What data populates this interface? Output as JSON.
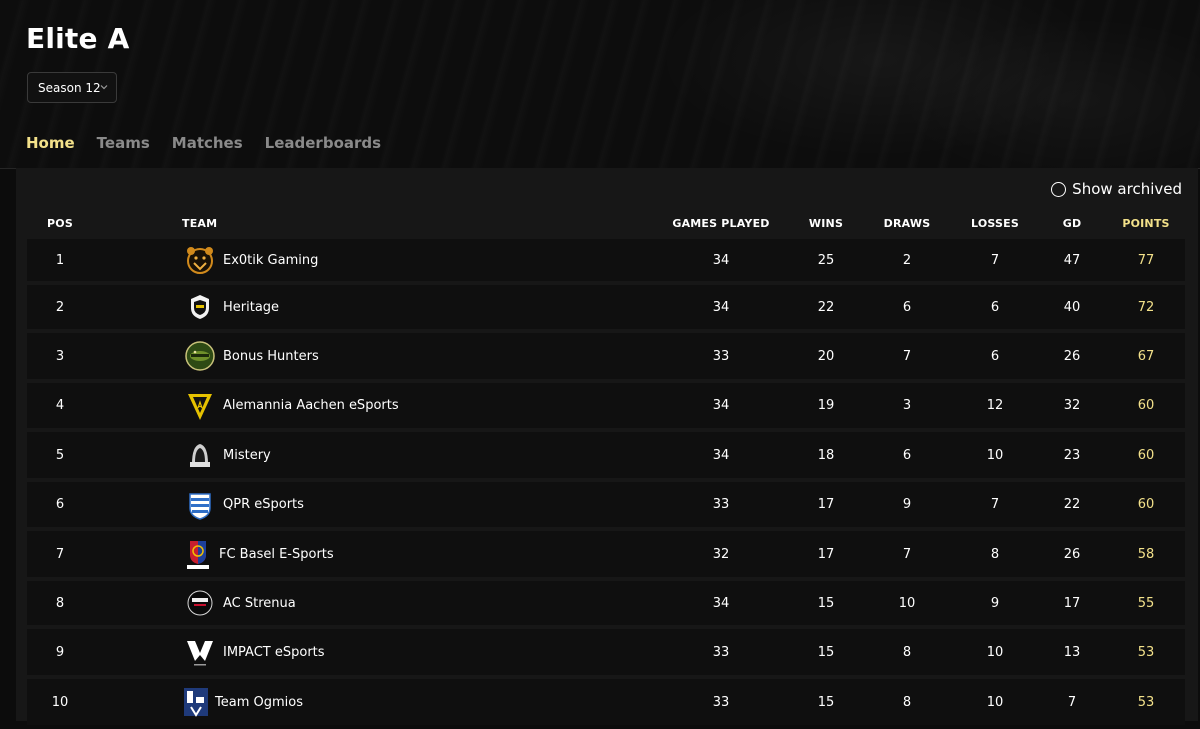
{
  "header": {
    "title": "Elite A",
    "season_select": {
      "value": "Season 12"
    }
  },
  "tabs": [
    {
      "label": "Home",
      "active": true
    },
    {
      "label": "Teams",
      "active": false
    },
    {
      "label": "Matches",
      "active": false
    },
    {
      "label": "Leaderboards",
      "active": false
    }
  ],
  "archived_toggle": {
    "label": "Show archived",
    "checked": false
  },
  "table": {
    "columns": [
      "POS",
      "TEAM",
      "GAMES PLAYED",
      "WINS",
      "DRAWS",
      "LOSSES",
      "GD",
      "POINTS"
    ],
    "rows": [
      {
        "pos": "1",
        "team": "Ex0tik Gaming",
        "played": "34",
        "wins": "25",
        "draws": "2",
        "losses": "7",
        "gd": "47",
        "points": "77",
        "logo": "bear-mascot-logo"
      },
      {
        "pos": "2",
        "team": "Heritage",
        "played": "34",
        "wins": "22",
        "draws": "6",
        "losses": "6",
        "gd": "40",
        "points": "72",
        "logo": "shield-logo"
      },
      {
        "pos": "3",
        "team": "Bonus Hunters",
        "played": "33",
        "wins": "20",
        "draws": "7",
        "losses": "6",
        "gd": "26",
        "points": "67",
        "logo": "green-crocodile-badge-logo"
      },
      {
        "pos": "4",
        "team": "Alemannia Aachen eSports",
        "played": "34",
        "wins": "19",
        "draws": "3",
        "losses": "12",
        "gd": "32",
        "points": "60",
        "logo": "yellow-triangle-logo"
      },
      {
        "pos": "5",
        "team": "Mistery",
        "played": "34",
        "wins": "18",
        "draws": "6",
        "losses": "10",
        "gd": "23",
        "points": "60",
        "logo": "hooded-figure-logo"
      },
      {
        "pos": "6",
        "team": "QPR eSports",
        "played": "33",
        "wins": "17",
        "draws": "9",
        "losses": "7",
        "gd": "22",
        "points": "60",
        "logo": "blue-hoops-crest-logo"
      },
      {
        "pos": "7",
        "team": "FC Basel E-Sports",
        "played": "32",
        "wins": "17",
        "draws": "7",
        "losses": "8",
        "gd": "26",
        "points": "58",
        "logo": "red-blue-crest-logo"
      },
      {
        "pos": "8",
        "team": "AC Strenua",
        "played": "34",
        "wins": "15",
        "draws": "10",
        "losses": "9",
        "gd": "17",
        "points": "55",
        "logo": "strenua-round-logo"
      },
      {
        "pos": "9",
        "team": "IMPACT eSports",
        "played": "33",
        "wins": "15",
        "draws": "8",
        "losses": "10",
        "gd": "13",
        "points": "53",
        "logo": "white-m-logo"
      },
      {
        "pos": "10",
        "team": "Team Ogmios",
        "played": "33",
        "wins": "15",
        "draws": "8",
        "losses": "10",
        "gd": "7",
        "points": "53",
        "logo": "blue-white-block-logo"
      }
    ]
  },
  "colors": {
    "accent": "#f3e18a",
    "background": "#0c0c0c",
    "panel": "#171717",
    "row": "#0f0f0f",
    "muted_tab": "#8a8a8a"
  }
}
